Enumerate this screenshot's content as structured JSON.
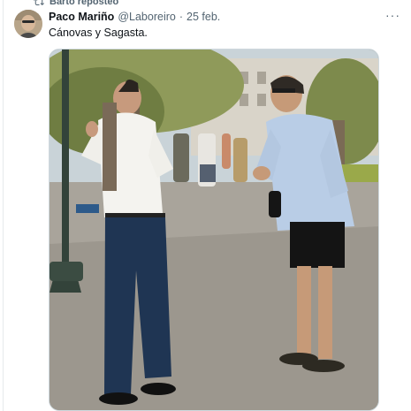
{
  "repost": {
    "icon": "repost-icon",
    "label": "Barto reposteó"
  },
  "tweet": {
    "author_name": "Paco Mariño",
    "handle": "@Laboreiro",
    "separator": "·",
    "date": "25 feb.",
    "text": "Cánovas y Sagasta.",
    "more_icon": "more-icon",
    "more_label": "···"
  },
  "colors": {
    "text": "#0f1419",
    "secondary": "#536471",
    "border": "#cfd9de"
  }
}
